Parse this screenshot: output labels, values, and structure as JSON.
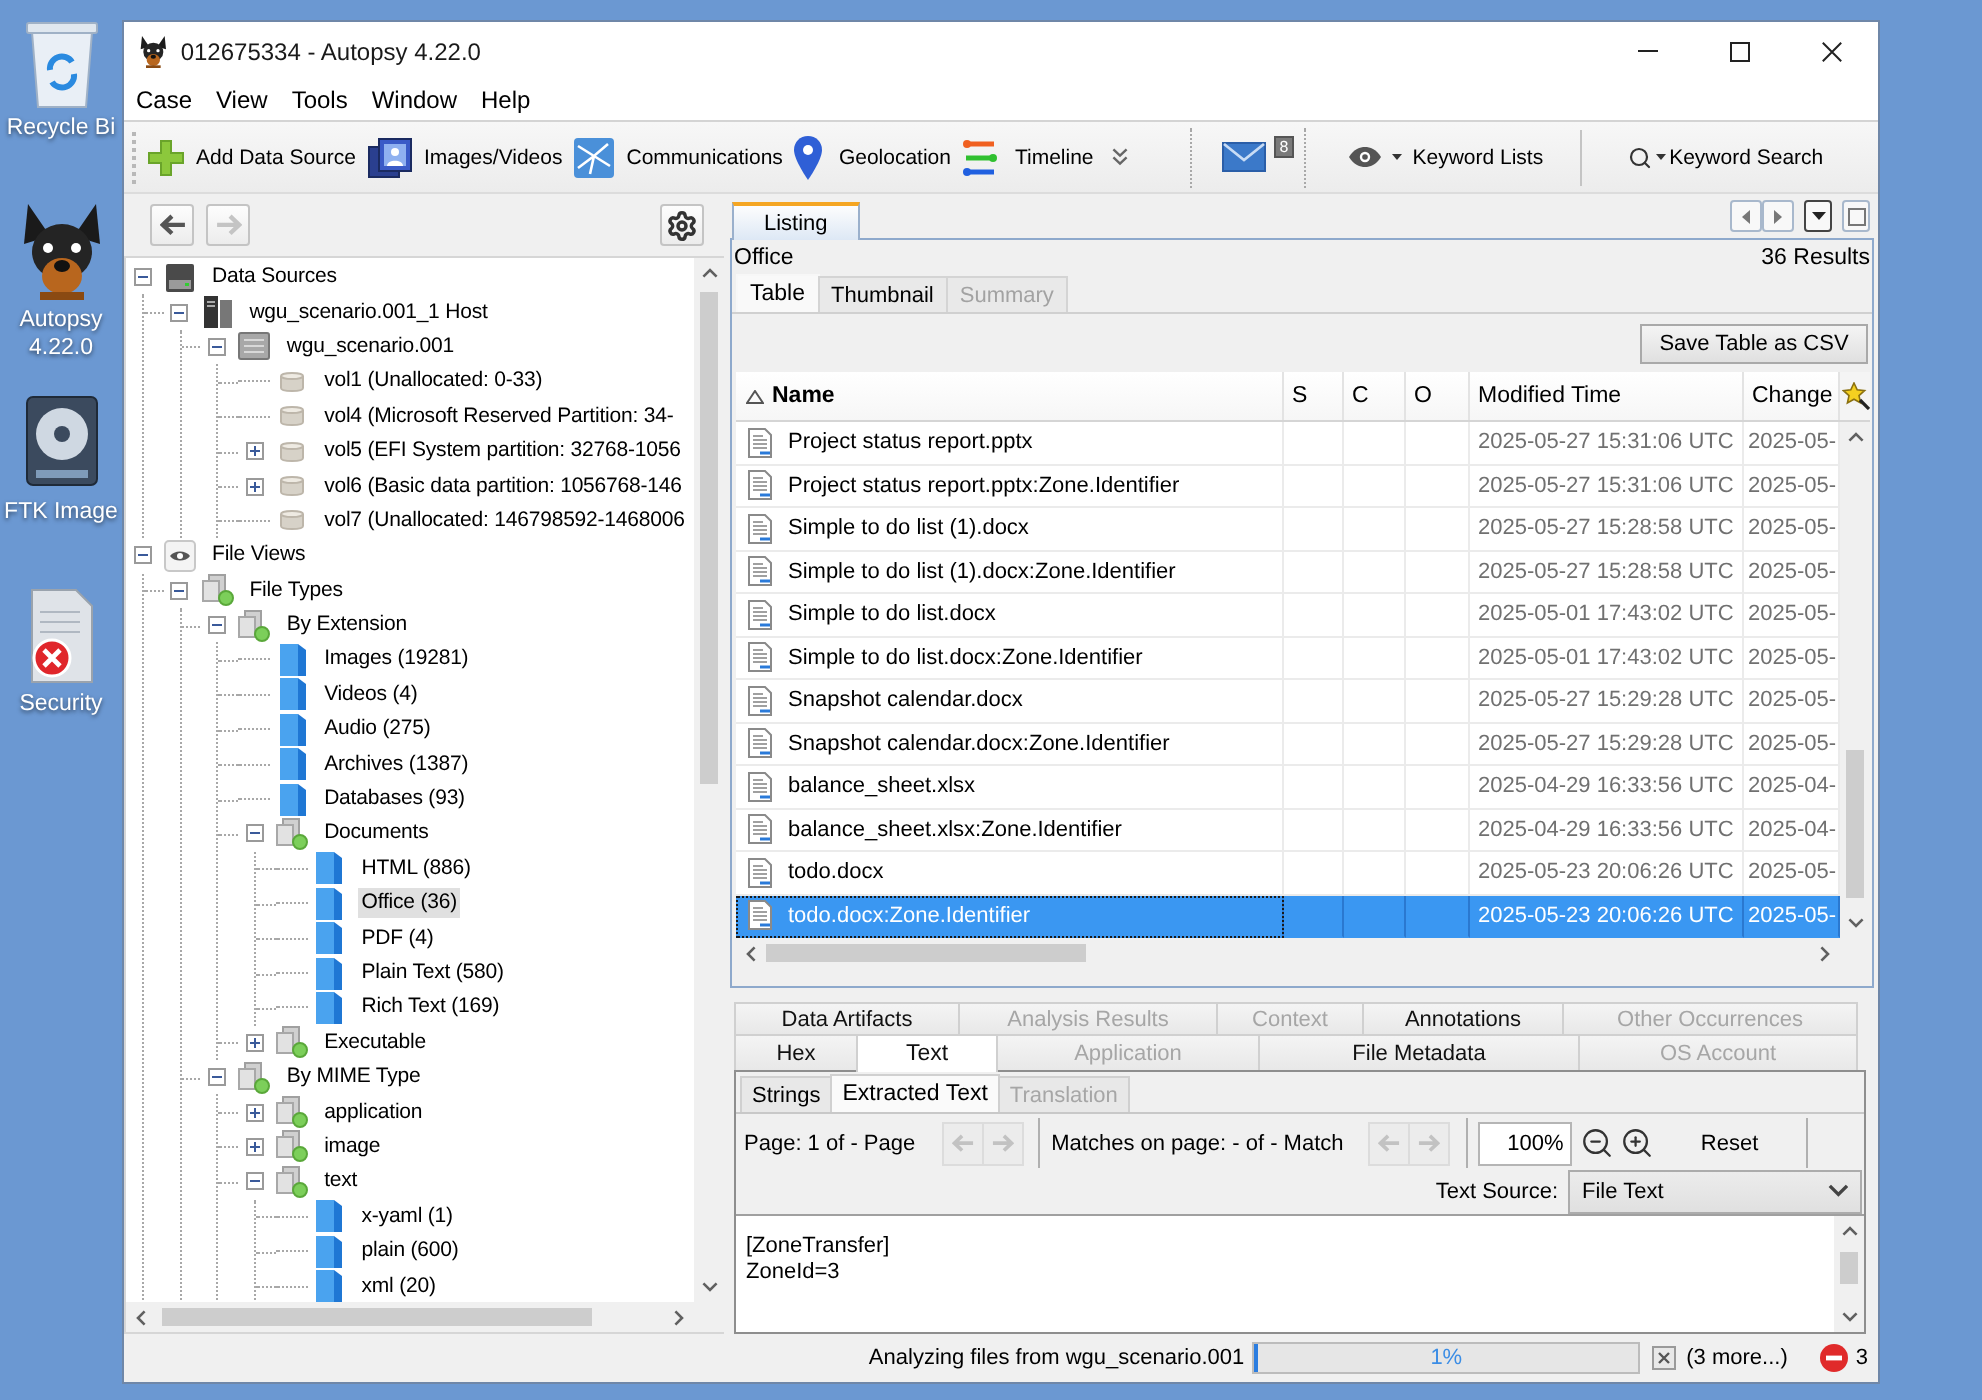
{
  "desktop": {
    "icons": [
      {
        "label": "Recycle Bi",
        "kind": "trash"
      },
      {
        "label": "Autopsy 4.22.0",
        "kind": "dog"
      },
      {
        "label": "FTK Image",
        "kind": "disk"
      },
      {
        "label": "Security",
        "kind": "shield"
      }
    ]
  },
  "window": {
    "title": "012675334 - Autopsy 4.22.0"
  },
  "menu": [
    "Case",
    "View",
    "Tools",
    "Window",
    "Help"
  ],
  "toolbar": {
    "tools": [
      {
        "label": "Add Data Source"
      },
      {
        "label": "Images/Videos"
      },
      {
        "label": "Communications"
      },
      {
        "label": "Geolocation"
      },
      {
        "label": "Timeline"
      }
    ],
    "messages": {
      "badge": "8"
    },
    "keyword_lists": {
      "label": "Keyword Lists"
    },
    "keyword_search": {
      "label": "Keyword Search"
    }
  },
  "history": {
    "back_enabled": true,
    "forward_enabled": false
  },
  "tree": [
    {
      "label": "Data Sources",
      "kind": "drive",
      "expanded": true,
      "selected": false,
      "children": [
        {
          "label": "wgu_scenario.001_1 Host",
          "kind": "host",
          "expanded": true,
          "selected": false,
          "children": [
            {
              "label": "wgu_scenario.001",
              "kind": "image",
              "expanded": true,
              "selected": false,
              "children": [
                {
                  "label": "vol1 (Unallocated: 0-33)",
                  "kind": "volume",
                  "selected": false
                },
                {
                  "label": "vol4 (Microsoft Reserved Partition: 34-",
                  "kind": "volume",
                  "selected": false
                },
                {
                  "label": "vol5 (EFI System partition: 32768-1056",
                  "kind": "volume",
                  "expanded": false,
                  "selected": false
                },
                {
                  "label": "vol6 (Basic data partition: 1056768-146",
                  "kind": "volume",
                  "expanded": false,
                  "selected": false
                },
                {
                  "label": "vol7 (Unallocated: 146798592-1468006",
                  "kind": "volume",
                  "selected": false
                }
              ]
            }
          ]
        }
      ]
    },
    {
      "label": "File Views",
      "kind": "view",
      "expanded": true,
      "selected": false,
      "children": [
        {
          "label": "File Types",
          "kind": "group",
          "expanded": true,
          "selected": false,
          "children": [
            {
              "label": "By Extension",
              "kind": "group",
              "expanded": true,
              "selected": false,
              "children": [
                {
                  "label": "Images (19281)",
                  "kind": "filetype",
                  "selected": false
                },
                {
                  "label": "Videos (4)",
                  "kind": "filetype",
                  "selected": false
                },
                {
                  "label": "Audio (275)",
                  "kind": "filetype",
                  "selected": false
                },
                {
                  "label": "Archives (1387)",
                  "kind": "filetype",
                  "selected": false
                },
                {
                  "label": "Databases (93)",
                  "kind": "filetype",
                  "selected": false
                },
                {
                  "label": "Documents",
                  "kind": "group",
                  "expanded": true,
                  "selected": false,
                  "children": [
                    {
                      "label": "HTML (886)",
                      "kind": "filetype",
                      "selected": false
                    },
                    {
                      "label": "Office (36)",
                      "kind": "filetype",
                      "selected": true
                    },
                    {
                      "label": "PDF (4)",
                      "kind": "filetype",
                      "selected": false
                    },
                    {
                      "label": "Plain Text (580)",
                      "kind": "filetype",
                      "selected": false
                    },
                    {
                      "label": "Rich Text (169)",
                      "kind": "filetype",
                      "selected": false
                    }
                  ]
                },
                {
                  "label": "Executable",
                  "kind": "group",
                  "expanded": false,
                  "selected": false
                }
              ]
            },
            {
              "label": "By MIME Type",
              "kind": "group",
              "expanded": true,
              "selected": false,
              "children": [
                {
                  "label": "application",
                  "kind": "group",
                  "expanded": false,
                  "selected": false
                },
                {
                  "label": "image",
                  "kind": "group",
                  "expanded": false,
                  "selected": false
                },
                {
                  "label": "text",
                  "kind": "group",
                  "expanded": true,
                  "selected": false,
                  "children": [
                    {
                      "label": "x-yaml (1)",
                      "kind": "filetype",
                      "selected": false
                    },
                    {
                      "label": "plain (600)",
                      "kind": "filetype",
                      "selected": false
                    },
                    {
                      "label": "xml (20)",
                      "kind": "filetype",
                      "selected": false
                    }
                  ]
                }
              ]
            }
          ]
        }
      ]
    }
  ],
  "listing": {
    "tab": "Listing",
    "node": "Office",
    "results": "36 Results",
    "view_tabs": [
      {
        "label": "Table",
        "selected": true,
        "disabled": false
      },
      {
        "label": "Thumbnail",
        "selected": false,
        "disabled": false
      },
      {
        "label": "Summary",
        "selected": false,
        "disabled": true
      }
    ],
    "save_button": "Save Table as CSV",
    "table": {
      "columns": [
        {
          "label": "Name",
          "sorted": true
        },
        {
          "label": "S",
          "sorted": false
        },
        {
          "label": "C",
          "sorted": false
        },
        {
          "label": "O",
          "sorted": false
        },
        {
          "label": "Modified Time",
          "sorted": false
        },
        {
          "label": "Change",
          "sorted": false
        }
      ],
      "rows": [
        {
          "name": "Project status report.pptx",
          "modified_time": "2025-05-27 15:31:06 UTC",
          "change": "2025-05-",
          "selected": false
        },
        {
          "name": "Project status report.pptx:Zone.Identifier",
          "modified_time": "2025-05-27 15:31:06 UTC",
          "change": "2025-05-",
          "selected": false
        },
        {
          "name": "Simple to do list (1).docx",
          "modified_time": "2025-05-27 15:28:58 UTC",
          "change": "2025-05-",
          "selected": false
        },
        {
          "name": "Simple to do list (1).docx:Zone.Identifier",
          "modified_time": "2025-05-27 15:28:58 UTC",
          "change": "2025-05-",
          "selected": false
        },
        {
          "name": "Simple to do list.docx",
          "modified_time": "2025-05-01 17:43:02 UTC",
          "change": "2025-05-",
          "selected": false
        },
        {
          "name": "Simple to do list.docx:Zone.Identifier",
          "modified_time": "2025-05-01 17:43:02 UTC",
          "change": "2025-05-",
          "selected": false
        },
        {
          "name": "Snapshot calendar.docx",
          "modified_time": "2025-05-27 15:29:28 UTC",
          "change": "2025-05-",
          "selected": false
        },
        {
          "name": "Snapshot calendar.docx:Zone.Identifier",
          "modified_time": "2025-05-27 15:29:28 UTC",
          "change": "2025-05-",
          "selected": false
        },
        {
          "name": "balance_sheet.xlsx",
          "modified_time": "2025-04-29 16:33:56 UTC",
          "change": "2025-04-",
          "selected": false
        },
        {
          "name": "balance_sheet.xlsx:Zone.Identifier",
          "modified_time": "2025-04-29 16:33:56 UTC",
          "change": "2025-04-",
          "selected": false
        },
        {
          "name": "todo.docx",
          "modified_time": "2025-05-23 20:06:26 UTC",
          "change": "2025-05-",
          "selected": false
        },
        {
          "name": "todo.docx:Zone.Identifier",
          "modified_time": "2025-05-23 20:06:26 UTC",
          "change": "2025-05-",
          "selected": true
        }
      ]
    }
  },
  "viewer": {
    "tab_rows": [
      [
        {
          "label": "Data Artifacts",
          "selected": false,
          "disabled": false
        },
        {
          "label": "Analysis Results",
          "selected": false,
          "disabled": true
        },
        {
          "label": "Context",
          "selected": false,
          "disabled": true
        },
        {
          "label": "Annotations",
          "selected": false,
          "disabled": false
        },
        {
          "label": "Other Occurrences",
          "selected": false,
          "disabled": true
        }
      ],
      [
        {
          "label": "Hex",
          "selected": false,
          "disabled": false
        },
        {
          "label": "Text",
          "selected": true,
          "disabled": false
        },
        {
          "label": "Application",
          "selected": false,
          "disabled": true
        },
        {
          "label": "File Metadata",
          "selected": false,
          "disabled": false
        },
        {
          "label": "OS Account",
          "selected": false,
          "disabled": true
        }
      ]
    ],
    "text_tabs": [
      {
        "label": "Strings",
        "selected": false,
        "disabled": false
      },
      {
        "label": "Extracted Text",
        "selected": true,
        "disabled": false
      },
      {
        "label": "Translation",
        "selected": false,
        "disabled": true
      }
    ],
    "page_label": "Page: 1 of - Page",
    "page_nav_enabled": false,
    "matches_label": "Matches on page: - of - Match",
    "match_nav_enabled": false,
    "zoom": "100%",
    "reset": "Reset",
    "text_source_label": "Text Source:",
    "text_source": "File Text",
    "text": [
      "[ZoneTransfer]",
      "ZoneId=3"
    ]
  },
  "status": {
    "message": "Analyzing files from wgu_scenario.001",
    "progress": {
      "level": 0.01,
      "label": "1%"
    },
    "more": "(3 more...)",
    "errors": "3"
  }
}
